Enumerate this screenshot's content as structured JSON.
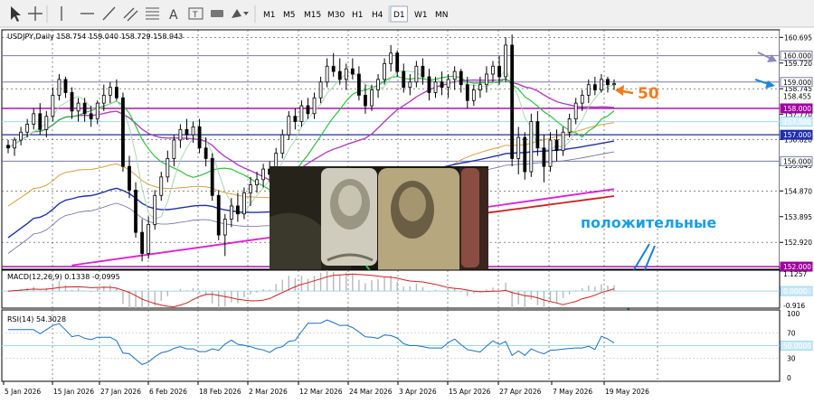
{
  "toolbar": {
    "tools": [
      "cursor-icon",
      "crosshair-icon",
      "vertical-line-icon",
      "horizontal-line-icon",
      "trendline-icon",
      "channel-icon",
      "fibonacci-icon",
      "text-tool-icon",
      "text-label-icon",
      "rectangle-icon",
      "shapes-dropdown-icon"
    ],
    "text_tool_glyph": "A",
    "label_tool_glyph": "T",
    "timeframes": [
      "M1",
      "M5",
      "M15",
      "M30",
      "H1",
      "H4",
      "D1",
      "W1",
      "MN"
    ],
    "active_timeframe": "D1"
  },
  "chart": {
    "symbol_line": "USDJPY,Daily  158.754 159.040 158.729 158.943",
    "price_axis": [
      "160.695",
      "159.720",
      "158.745",
      "157.770",
      "156.820",
      "155.845",
      "154.870",
      "153.895",
      "152.920",
      "151.945"
    ],
    "price_tags": [
      {
        "label": "160.000",
        "price": 160.0,
        "style": "line",
        "color": "#7a7aa8"
      },
      {
        "label": "159.000",
        "price": 159.0,
        "style": "line",
        "color": "#7a7aa8"
      },
      {
        "label": "158.455",
        "price": 158.455,
        "style": "plain",
        "color": "#000000"
      },
      {
        "label": "158.000",
        "price": 158.0,
        "style": "magenta",
        "color": "#a000a0"
      },
      {
        "label": "157.500",
        "price": 157.5,
        "style": "cyan",
        "color": "#9fd9ef"
      },
      {
        "label": "157.000",
        "price": 157.0,
        "style": "blue",
        "color": "#1f2fb0"
      },
      {
        "label": "156.000",
        "price": 156.0,
        "style": "line",
        "color": "#7a7aa8"
      },
      {
        "label": "152.000",
        "price": 152.0,
        "style": "magenta",
        "color": "#a000a0"
      }
    ],
    "annotation_50": "50",
    "annotation_positive": "положительные",
    "price_ylim": [
      151.9,
      160.98
    ]
  },
  "macd": {
    "title": "MACD(12,26,9) 0.1338 -0.0995",
    "axis": [
      "1.1257",
      "0.0000",
      "-0.916"
    ]
  },
  "rsi": {
    "title": "RSI(14) 54.3028",
    "axis": [
      "100",
      "70",
      "50.0000",
      "30",
      "0"
    ]
  },
  "time_axis": [
    "5 Jan 2026",
    "15 Jan 2026",
    "27 Jan 2026",
    "6 Feb 2026",
    "18 Feb 2026",
    "2 Mar 2026",
    "12 Mar 2026",
    "24 Mar 2026",
    "3 Apr 2026",
    "15 Apr 2026",
    "27 Apr 2026",
    "7 May 2026",
    "19 May 2026"
  ],
  "chart_data": {
    "type": "candlestick",
    "symbol": "USDJPY",
    "timeframe": "Daily",
    "x_start": "2026-01-02",
    "x_step_days": 1,
    "ohlc": [
      [
        156.6,
        156.8,
        156.3,
        156.5
      ],
      [
        156.5,
        156.9,
        156.2,
        156.8
      ],
      [
        156.8,
        157.3,
        156.6,
        157.1
      ],
      [
        157.1,
        157.6,
        156.9,
        157.4
      ],
      [
        157.4,
        158.0,
        157.2,
        157.8
      ],
      [
        157.8,
        158.2,
        157.0,
        157.2
      ],
      [
        157.2,
        157.9,
        156.9,
        157.7
      ],
      [
        157.7,
        158.8,
        157.5,
        158.5
      ],
      [
        158.5,
        159.3,
        158.3,
        159.1
      ],
      [
        159.1,
        159.2,
        158.4,
        158.6
      ],
      [
        158.6,
        158.8,
        157.6,
        157.9
      ],
      [
        157.9,
        158.4,
        157.5,
        158.2
      ],
      [
        158.2,
        158.4,
        157.5,
        157.8
      ],
      [
        157.8,
        158.1,
        157.3,
        157.6
      ],
      [
        157.6,
        158.3,
        157.4,
        158.2
      ],
      [
        158.2,
        158.9,
        157.9,
        158.5
      ],
      [
        158.5,
        159.0,
        158.2,
        158.8
      ],
      [
        158.8,
        159.1,
        158.3,
        158.4
      ],
      [
        158.4,
        158.6,
        155.6,
        155.8
      ],
      [
        155.8,
        156.2,
        154.6,
        154.9
      ],
      [
        154.9,
        155.2,
        153.1,
        153.3
      ],
      [
        153.3,
        153.8,
        152.2,
        152.5
      ],
      [
        152.5,
        153.9,
        152.3,
        153.6
      ],
      [
        153.6,
        154.9,
        153.4,
        154.7
      ],
      [
        154.7,
        155.6,
        154.5,
        155.4
      ],
      [
        155.4,
        156.4,
        155.2,
        156.1
      ],
      [
        156.1,
        157.0,
        155.8,
        156.8
      ],
      [
        156.8,
        157.4,
        156.5,
        157.2
      ],
      [
        157.2,
        157.6,
        156.8,
        157.0
      ],
      [
        157.0,
        157.5,
        156.7,
        157.3
      ],
      [
        157.3,
        157.6,
        156.3,
        156.5
      ],
      [
        156.5,
        156.9,
        155.8,
        156.1
      ],
      [
        156.1,
        156.3,
        154.5,
        154.7
      ],
      [
        154.7,
        154.9,
        153.0,
        153.2
      ],
      [
        153.2,
        154.0,
        152.4,
        153.8
      ],
      [
        153.8,
        154.6,
        153.5,
        154.3
      ],
      [
        154.3,
        154.8,
        153.7,
        154.0
      ],
      [
        154.0,
        155.0,
        153.8,
        154.8
      ],
      [
        154.8,
        155.4,
        154.3,
        155.1
      ],
      [
        155.1,
        155.6,
        154.8,
        155.3
      ],
      [
        155.3,
        155.9,
        155.0,
        155.7
      ],
      [
        155.7,
        156.0,
        155.2,
        155.5
      ],
      [
        155.5,
        156.5,
        155.3,
        156.3
      ],
      [
        156.3,
        157.2,
        156.1,
        157.0
      ],
      [
        157.0,
        157.9,
        156.8,
        157.7
      ],
      [
        157.7,
        158.0,
        157.2,
        157.5
      ],
      [
        157.5,
        158.3,
        157.3,
        158.1
      ],
      [
        158.1,
        158.4,
        157.6,
        157.8
      ],
      [
        157.8,
        158.6,
        157.6,
        158.4
      ],
      [
        158.4,
        159.2,
        158.2,
        159.0
      ],
      [
        159.0,
        159.9,
        158.8,
        159.6
      ],
      [
        159.6,
        160.1,
        159.2,
        159.4
      ],
      [
        159.4,
        159.9,
        158.9,
        159.1
      ],
      [
        159.1,
        159.7,
        158.7,
        159.5
      ],
      [
        159.5,
        159.9,
        159.1,
        159.3
      ],
      [
        159.3,
        159.6,
        158.3,
        158.5
      ],
      [
        158.5,
        158.9,
        157.8,
        158.1
      ],
      [
        158.1,
        158.9,
        157.9,
        158.7
      ],
      [
        158.7,
        159.3,
        158.4,
        159.1
      ],
      [
        159.1,
        159.9,
        158.9,
        159.7
      ],
      [
        159.7,
        160.4,
        159.4,
        160.1
      ],
      [
        160.1,
        160.2,
        159.2,
        159.4
      ],
      [
        159.4,
        159.7,
        158.6,
        158.8
      ],
      [
        158.8,
        159.3,
        158.5,
        159.0
      ],
      [
        159.0,
        159.8,
        158.8,
        159.6
      ],
      [
        159.6,
        159.9,
        158.9,
        159.2
      ],
      [
        159.2,
        159.5,
        158.3,
        158.6
      ],
      [
        158.6,
        159.2,
        158.4,
        159.0
      ],
      [
        159.0,
        159.4,
        158.5,
        158.8
      ],
      [
        158.8,
        159.3,
        158.4,
        159.1
      ],
      [
        159.1,
        159.6,
        158.7,
        159.4
      ],
      [
        159.4,
        159.5,
        158.6,
        158.9
      ],
      [
        158.9,
        159.2,
        158.0,
        158.3
      ],
      [
        158.3,
        158.9,
        158.1,
        158.7
      ],
      [
        158.7,
        159.2,
        158.4,
        158.9
      ],
      [
        158.9,
        159.6,
        158.6,
        159.3
      ],
      [
        159.3,
        159.8,
        159.0,
        159.6
      ],
      [
        159.6,
        160.0,
        158.9,
        159.2
      ],
      [
        159.2,
        160.7,
        159.0,
        160.4
      ],
      [
        160.4,
        160.8,
        155.8,
        156.1
      ],
      [
        156.1,
        157.3,
        155.5,
        156.9
      ],
      [
        156.9,
        157.1,
        155.3,
        155.6
      ],
      [
        155.6,
        157.8,
        155.4,
        157.5
      ],
      [
        157.5,
        157.9,
        156.2,
        156.5
      ],
      [
        156.5,
        157.0,
        155.2,
        155.8
      ],
      [
        155.8,
        157.1,
        155.6,
        156.8
      ],
      [
        156.8,
        157.2,
        156.0,
        156.4
      ],
      [
        156.4,
        157.3,
        156.2,
        157.1
      ],
      [
        157.1,
        157.8,
        156.9,
        157.6
      ],
      [
        157.6,
        158.4,
        157.4,
        158.2
      ],
      [
        158.2,
        158.7,
        157.9,
        158.5
      ],
      [
        158.5,
        159.1,
        158.2,
        158.9
      ],
      [
        158.9,
        159.2,
        158.5,
        158.7
      ],
      [
        158.7,
        159.3,
        158.6,
        159.1
      ],
      [
        159.1,
        159.2,
        158.6,
        158.9
      ],
      [
        158.9,
        159.1,
        158.7,
        158.94
      ]
    ],
    "price_range": [
      151.9,
      160.98
    ],
    "macd": {
      "main": 0.1338,
      "signal": -0.0995,
      "ylim": [
        -0.916,
        1.1257
      ]
    },
    "rsi": {
      "value": 54.3028,
      "ylim": [
        0,
        100
      ],
      "levels": [
        70,
        50,
        30
      ]
    }
  }
}
